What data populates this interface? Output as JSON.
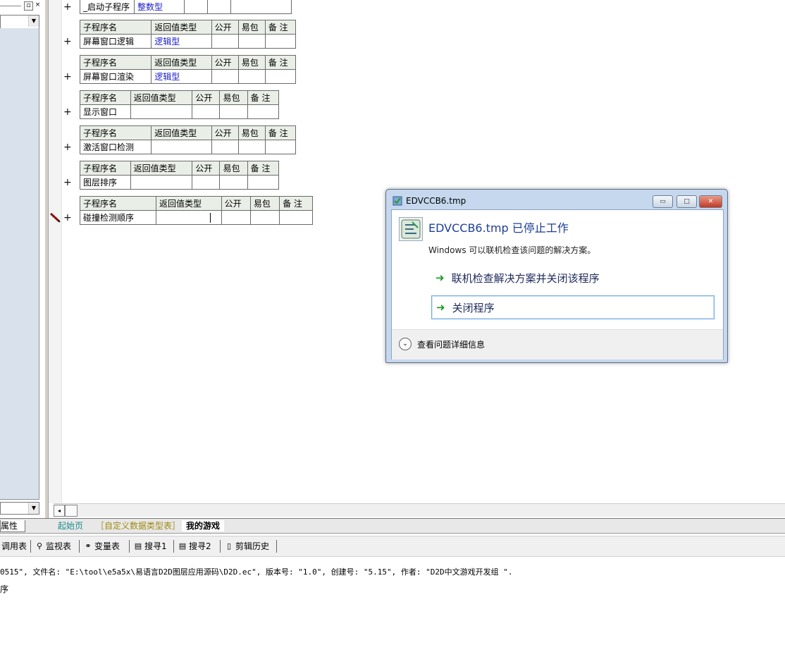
{
  "left": {
    "tab_attributes": "属性",
    "pin_glyph": "▫",
    "close_glyph": "×",
    "dropdown_glyph": "▼"
  },
  "editor": {
    "row_marker": "+",
    "header": [
      "子程序名",
      "返回值类型",
      "公开",
      "易包",
      "备 注"
    ],
    "subs": [
      {
        "name": "_启动子程序",
        "ret": "整数型"
      },
      {
        "name": "屏幕窗口逻辑",
        "ret": "逻辑型"
      },
      {
        "name": "屏幕窗口渲染",
        "ret": "逻辑型"
      },
      {
        "name": "显示窗口",
        "ret": ""
      },
      {
        "name": "激活窗口检测",
        "ret": ""
      },
      {
        "name": "图层排序",
        "ret": ""
      },
      {
        "name": "碰撞检测顺序",
        "ret": ""
      }
    ]
  },
  "scroll_left_glyph": "◂",
  "tabs": {
    "home": "起始页",
    "custom_types": "［自定义数据类型表］",
    "my_game": "我的游戏"
  },
  "toolbar": {
    "calls": "调用表",
    "watch": "监视表",
    "vars": "变量表",
    "search1": "搜寻1",
    "search2": "搜寻2",
    "clip_history": "剪辑历史"
  },
  "output": {
    "line1": "0515\", 文件名: \"E:\\tool\\e5a5x\\易语言D2D图层应用源码\\D2D.ec\", 版本号: \"1.0\", 创建号: \"5.15\", 作者: \"D2D中文游戏开发组  \".",
    "line2": "序"
  },
  "dialog": {
    "title": "EDVCCB6.tmp",
    "heading": "EDVCCB6.tmp 已停止工作",
    "subtext": "Windows 可以联机检查该问题的解决方案。",
    "option1": "联机检查解决方案并关闭该程序",
    "option2": "关闭程序",
    "details": "查看问题详细信息",
    "arrow_glyph": "➜",
    "minimize_glyph": "▭",
    "maximize_glyph": "□",
    "close_glyph": "✕",
    "chevron_glyph": "⌄"
  }
}
